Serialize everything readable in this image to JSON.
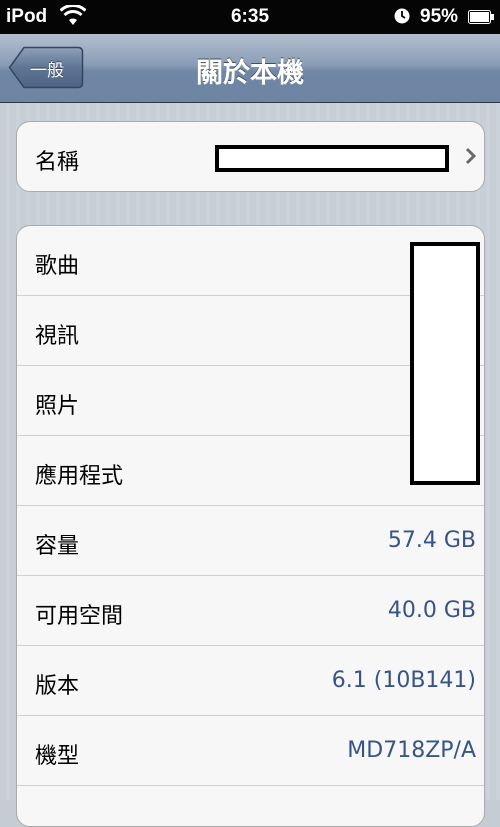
{
  "status_bar": {
    "carrier": "iPod",
    "time": "6:35",
    "battery_percent": "95%"
  },
  "nav": {
    "back_label": "一般",
    "title": "關於本機"
  },
  "name_row": {
    "label": "名稱"
  },
  "info_rows": [
    {
      "label": "歌曲",
      "value": ""
    },
    {
      "label": "視訊",
      "value": ""
    },
    {
      "label": "照片",
      "value": ""
    },
    {
      "label": "應用程式",
      "value": ""
    },
    {
      "label": "容量",
      "value": "57.4 GB"
    },
    {
      "label": "可用空間",
      "value": "40.0 GB"
    },
    {
      "label": "版本",
      "value": "6.1 (10B141)"
    },
    {
      "label": "機型",
      "value": "MD718ZP/A"
    }
  ],
  "colors": {
    "value_text": "#385487",
    "nav_gradient_top": "#b3bfcf",
    "nav_gradient_bottom": "#6d85a3"
  }
}
